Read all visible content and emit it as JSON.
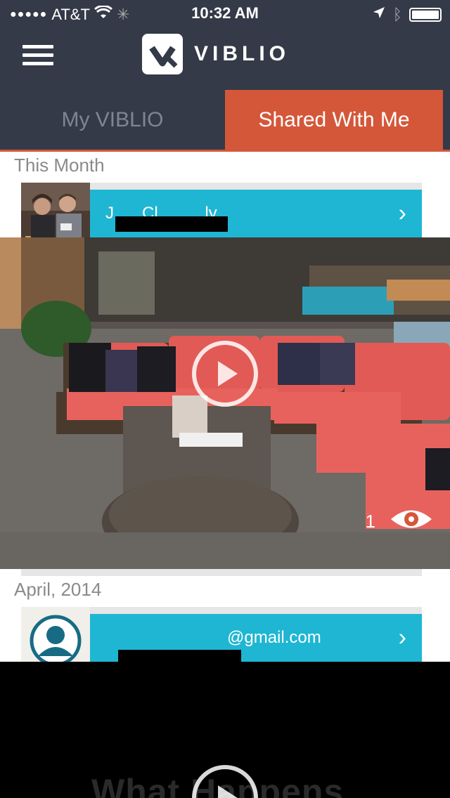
{
  "status_bar": {
    "carrier": "AT&T",
    "time": "10:32 AM"
  },
  "header": {
    "brand": "VIBLIO",
    "menu_icon": "hamburger-menu-icon",
    "logo_icon": "viblio-logo-icon"
  },
  "tabs": [
    {
      "label": "My VIBLIO",
      "active": false
    },
    {
      "label": "Shared With Me",
      "active": true
    }
  ],
  "groups": [
    {
      "section": "This Month",
      "sharer": {
        "name_visible": "J      Cl          ly"
      },
      "video": {
        "views": "1",
        "view_icon": "eye-icon",
        "play_icon": "play-icon"
      }
    },
    {
      "section": "April, 2014",
      "sharer": {
        "name_visible": "@gmail.com"
      },
      "video": {
        "title_text": "What Happens"
      }
    }
  ],
  "colors": {
    "header_bg": "#343a47",
    "active_tab": "#d4573a",
    "sharer_bar": "#1fb6d3"
  }
}
